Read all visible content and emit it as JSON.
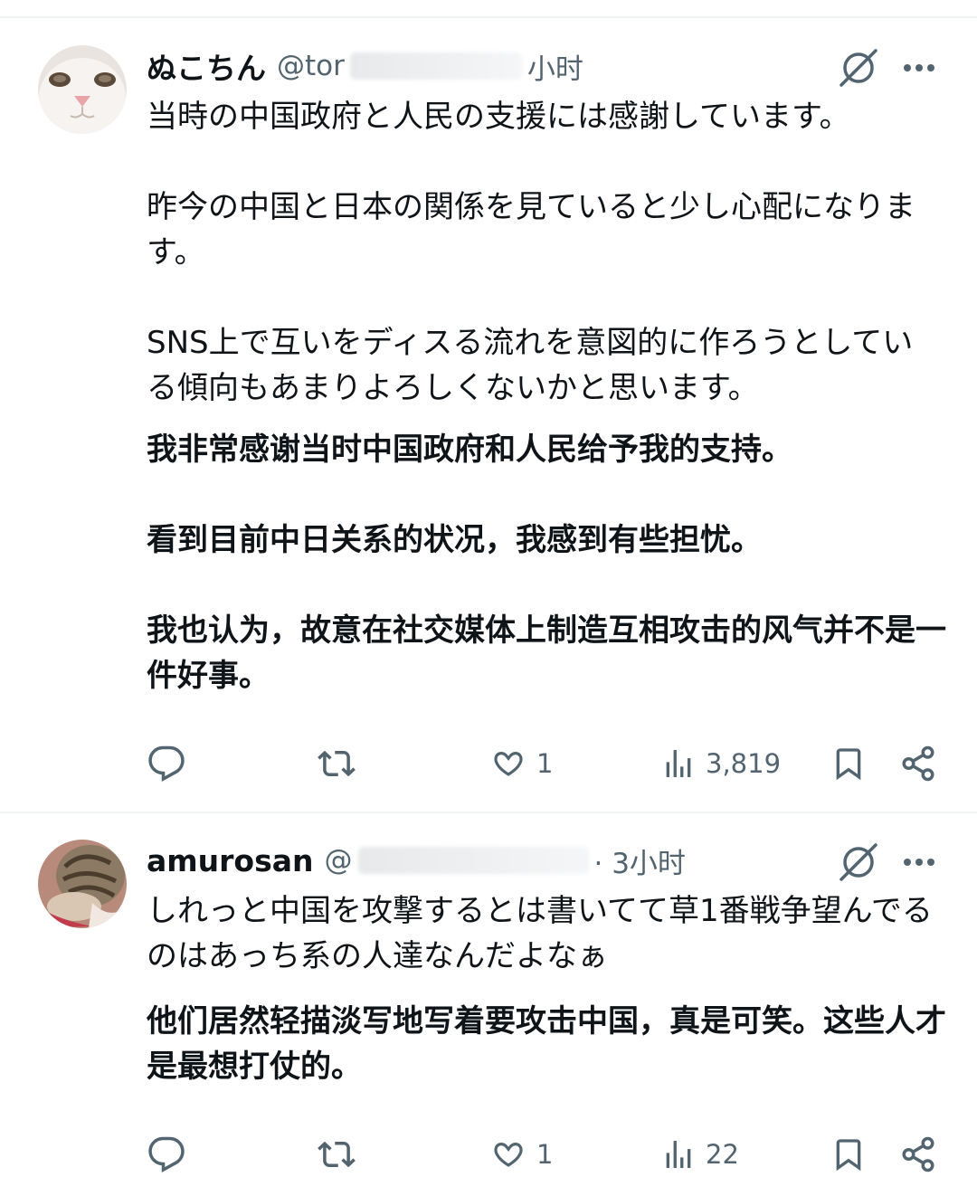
{
  "posts": [
    {
      "display_name": "ぬこちん",
      "handle_visible": "@tor",
      "time": "小时",
      "avatar_icon": "white-cat-avatar",
      "text": "当時の中国政府と人民の支援には感謝しています。\n\n昨今の中国と日本の関係を見ていると少し心配になります。\n\nSNS上で互いをディスる流れを意図的に作ろうとしている傾向もあまりよろしくないかと思います。",
      "translation": "我非常感谢当时中国政府和人民给予我的支持。\n\n看到目前中日关系的状况，我感到有些担忧。\n\n我也认为，故意在社交媒体上制造互相攻击的风气并不是一件好事。",
      "stats": {
        "replies": "",
        "reposts": "",
        "likes": "1",
        "views": "3,819"
      }
    },
    {
      "display_name": "amurosan",
      "handle_visible": "@",
      "time": "· 3小时",
      "avatar_icon": "tabby-cat-avatar",
      "text": "しれっと中国を攻撃するとは書いてて草1番戦争望んでるのはあっち系の人達なんだよなぁ",
      "translation": "他们居然轻描淡写地写着要攻击中国，真是可笑。这些人才是最想打仗的。",
      "stats": {
        "replies": "",
        "reposts": "",
        "likes": "1",
        "views": "22"
      }
    }
  ],
  "colors": {
    "text": "#0f1419",
    "muted": "#536471",
    "divider": "#eff3f4"
  }
}
